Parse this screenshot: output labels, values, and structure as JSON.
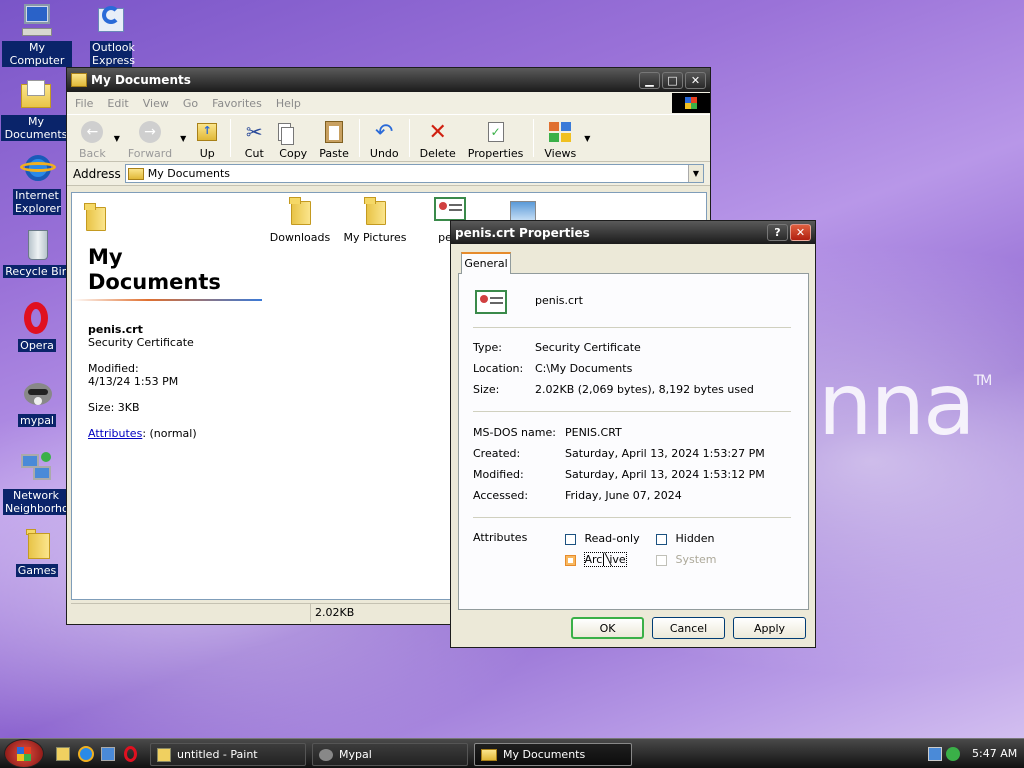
{
  "brand_watermark": "nna",
  "brand_tm": "TM",
  "desktop": [
    {
      "label": "My Computer"
    },
    {
      "label": "Outlook Express"
    },
    {
      "label": "My Documents"
    },
    {
      "label": "Internet Explorer"
    },
    {
      "label": "Recycle Bin"
    },
    {
      "label": "Opera"
    },
    {
      "label": "mypal"
    },
    {
      "label": "Network Neighborhood"
    },
    {
      "label": "Games"
    }
  ],
  "explorer": {
    "title": "My Documents",
    "menu": [
      "File",
      "Edit",
      "View",
      "Go",
      "Favorites",
      "Help"
    ],
    "toolbar": {
      "back": "Back",
      "forward": "Forward",
      "up": "Up",
      "cut": "Cut",
      "copy": "Copy",
      "paste": "Paste",
      "undo": "Undo",
      "delete": "Delete",
      "properties": "Properties",
      "views": "Views"
    },
    "address_label": "Address",
    "address_value": "My Documents",
    "panel": {
      "heading": "My Documents",
      "file_name": "penis.crt",
      "file_type": "Security Certificate",
      "modified_label": "Modified:",
      "modified_value": "4/13/24 1:53 PM",
      "size": "Size: 3KB",
      "attributes_link": "Attributes",
      "attributes_value": ": (normal)"
    },
    "items": [
      {
        "label": "Downloads"
      },
      {
        "label": "My Pictures"
      },
      {
        "label": "peni"
      }
    ],
    "status_size": "2.02KB"
  },
  "dialog": {
    "title": "penis.crt Properties",
    "tab": "General",
    "file_name": "penis.crt",
    "type_label": "Type:",
    "type_value": "Security Certificate",
    "location_label": "Location:",
    "location_value": "C:\\My Documents",
    "size_label": "Size:",
    "size_value": "2.02KB (2,069 bytes), 8,192 bytes used",
    "msdos_label": "MS-DOS name:",
    "msdos_value": "PENIS.CRT",
    "created_label": "Created:",
    "created_value": "Saturday, April 13, 2024 1:53:27 PM",
    "modified_label": "Modified:",
    "modified_value": "Saturday, April 13, 2024 1:53:12 PM",
    "accessed_label": "Accessed:",
    "accessed_value": "Friday, June 07, 2024",
    "attributes_label": "Attributes",
    "readonly": "Read-only",
    "hidden": "Hidden",
    "archive": "Archive",
    "system": "System",
    "ok": "OK",
    "cancel": "Cancel",
    "apply": "Apply"
  },
  "taskbar": {
    "tasks": [
      {
        "label": "untitled - Paint"
      },
      {
        "label": "Mypal"
      },
      {
        "label": "My Documents"
      }
    ],
    "clock": "5:47 AM"
  }
}
